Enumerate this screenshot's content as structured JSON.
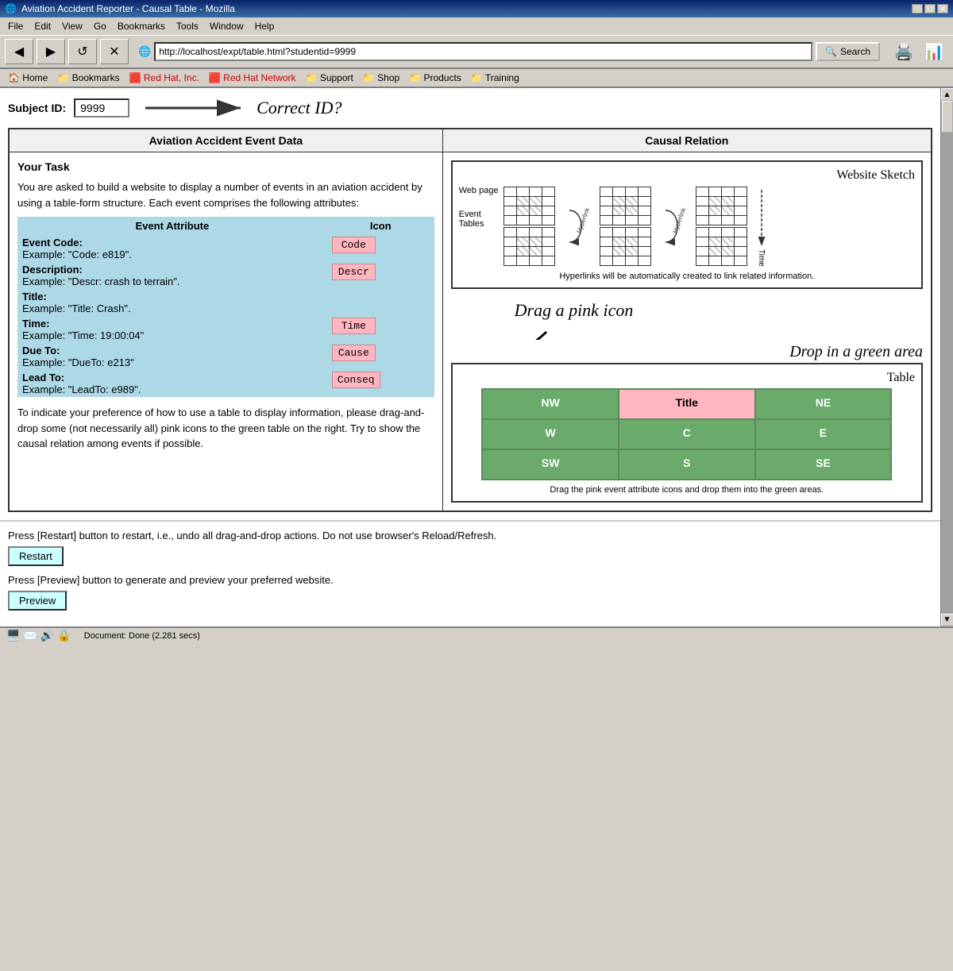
{
  "window": {
    "title": "Aviation Accident Reporter - Causal Table - Mozilla",
    "controls": [
      "_",
      "□",
      "✕"
    ]
  },
  "menubar": {
    "items": [
      "File",
      "Edit",
      "View",
      "Go",
      "Bookmarks",
      "Tools",
      "Window",
      "Help"
    ]
  },
  "toolbar": {
    "back_label": "←",
    "forward_label": "→",
    "reload_label": "↺",
    "stop_label": "✕",
    "address": "http://localhost/expt/table.html?studentid=9999",
    "search_label": "Search"
  },
  "bookmarks": {
    "items": [
      "🏠 Home",
      "📁 Bookmarks",
      "🟥 Red Hat, Inc.",
      "🟥 Red Hat Network",
      "📁 Support",
      "📁 Shop",
      "📁 Products",
      "📁 Training"
    ]
  },
  "subject_id": {
    "label": "Subject ID:",
    "value": "9999",
    "correct_id_text": "Correct ID?"
  },
  "main_table": {
    "left_header": "Aviation Accident Event Data",
    "right_header": "Causal Relation"
  },
  "left_col": {
    "task_title": "Your Task",
    "task_text1": "You are asked to build a website to display a number of events in an aviation accident by using a table-form structure. Each event comprises the following attributes:",
    "event_attr_header_attr": "Event Attribute",
    "event_attr_header_icon": "Icon",
    "attributes": [
      {
        "label": "Event Code:",
        "example": "Example: \"Code: e819\".",
        "icon": "Code"
      },
      {
        "label": "Description:",
        "example": "Example: \"Descr: crash to terrain\".",
        "icon": "Descr"
      },
      {
        "label": "Title:",
        "example": "Example: \"Title: Crash\".",
        "icon": null
      },
      {
        "label": "Time:",
        "example": "Example: \"Time: 19:00:04\"",
        "icon": "Time"
      },
      {
        "label": "Due To:",
        "example": "Example: \"DueTo: e213\"",
        "icon": "Cause"
      },
      {
        "label": "Lead To:",
        "example": "Example: \"LeadTo: e989\".",
        "icon": "Conseq"
      }
    ],
    "task_text2": "To indicate your preference of how to use a table to display information, please drag-and-drop some (not necessarily all) pink icons to the green table on the right. Try to show the causal relation among events if possible."
  },
  "right_col": {
    "sketch": {
      "title": "Website Sketch",
      "web_page_label": "Web page",
      "event_tables_label": "Event\nTables",
      "note": "Hyperlinks will be automatically created to link related information."
    },
    "drag_annotation": "Drag a pink icon",
    "drop_annotation": "Drop in a green area",
    "table": {
      "title": "Table",
      "cells": [
        [
          "NW",
          "Title",
          "NE"
        ],
        [
          "W",
          "C",
          "E"
        ],
        [
          "SW",
          "S",
          "SE"
        ]
      ],
      "note": "Drag the pink event attribute icons and drop them into the green areas.",
      "title_cell": "Title"
    }
  },
  "bottom": {
    "restart_text": "Press [Restart] button to restart, i.e., undo all drag-and-drop actions. Do not use browser's Reload/Refresh.",
    "restart_label": "Restart",
    "preview_text": "Press [Preview] button to generate and preview your preferred website.",
    "preview_label": "Preview"
  },
  "statusbar": {
    "text": "Document: Done (2.281 secs)"
  }
}
